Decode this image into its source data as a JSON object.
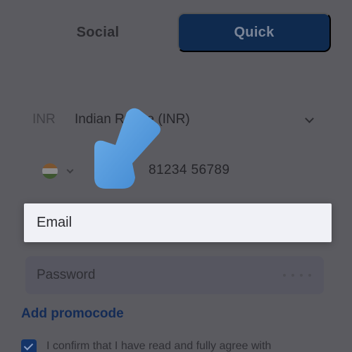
{
  "tabs": {
    "social": "Social",
    "quick": "Quick"
  },
  "currency": {
    "code": "INR",
    "name": "Indian Rupee (INR)"
  },
  "phone": {
    "country_flag": "india-flag-icon",
    "value": "81234 56789"
  },
  "email": {
    "placeholder": "Email"
  },
  "password": {
    "placeholder": "Password"
  },
  "promo": {
    "label": "Add promocode"
  },
  "terms": {
    "text": "I confirm that I have read and fully agree with"
  },
  "colors": {
    "accent": "#0f2a4e",
    "overlay": "#5b5b60",
    "pointer_arrow": "#4d95d8"
  }
}
